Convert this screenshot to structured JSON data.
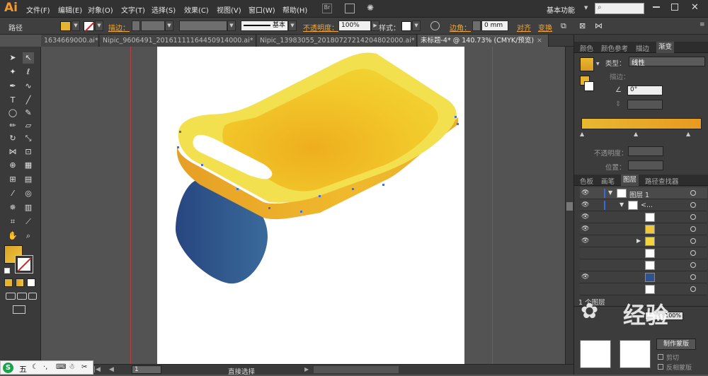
{
  "app": {
    "logo": "Ai"
  },
  "menus": [
    "文件(F)",
    "编辑(E)",
    "对象(O)",
    "文字(T)",
    "选择(S)",
    "效果(C)",
    "视图(V)",
    "窗口(W)",
    "帮助(H)"
  ],
  "workspace": {
    "label": "基本功能"
  },
  "control": {
    "object_type": "路径",
    "stroke_label": "描边：",
    "stroke_style": "基本",
    "opacity_label": "不透明度：",
    "opacity_value": "100%",
    "style_label": "样式：",
    "corner_label": "边角：",
    "corner_value": "0 mm",
    "align_label": "对齐",
    "transform_label": "变换"
  },
  "doc_tabs": [
    {
      "label": "1634669000.ai*"
    },
    {
      "label": "Nipic_9606491_20161111164450914000.ai*"
    },
    {
      "label": "Nipic_13983055_20180727214204802000.ai*"
    },
    {
      "label": "未标题-4* @ 140.73% (CMYK/预览)"
    }
  ],
  "panels": {
    "top_tabs": [
      "颜色",
      "颜色参考",
      "描边",
      "渐变"
    ],
    "gradient": {
      "type_label": "类型：",
      "type_value": "线性",
      "stroke_label": "描边：",
      "angle_value": "0°",
      "opacity_label": "不透明度：",
      "position_label": "位置：",
      "start_color": "#e8b830",
      "end_color": "#e89a20"
    },
    "layer_tabs": [
      "色板",
      "画笔",
      "图层",
      "路径查找器"
    ],
    "layers": {
      "top_layer": "图层 1",
      "group": "<...",
      "count_label": "1 个图层"
    }
  },
  "status": {
    "tool_name": "直接选择",
    "page_num": "1"
  },
  "watermark": {
    "text": "经验"
  },
  "colors": {
    "fill": "#e5b52f",
    "yellow_light": "#f3e451",
    "yellow_mid": "#f2d232",
    "yellow_dark": "#e9a828",
    "blue_left": "#27467f",
    "blue_right": "#3a6a9b"
  },
  "ime": {
    "label": "五"
  }
}
